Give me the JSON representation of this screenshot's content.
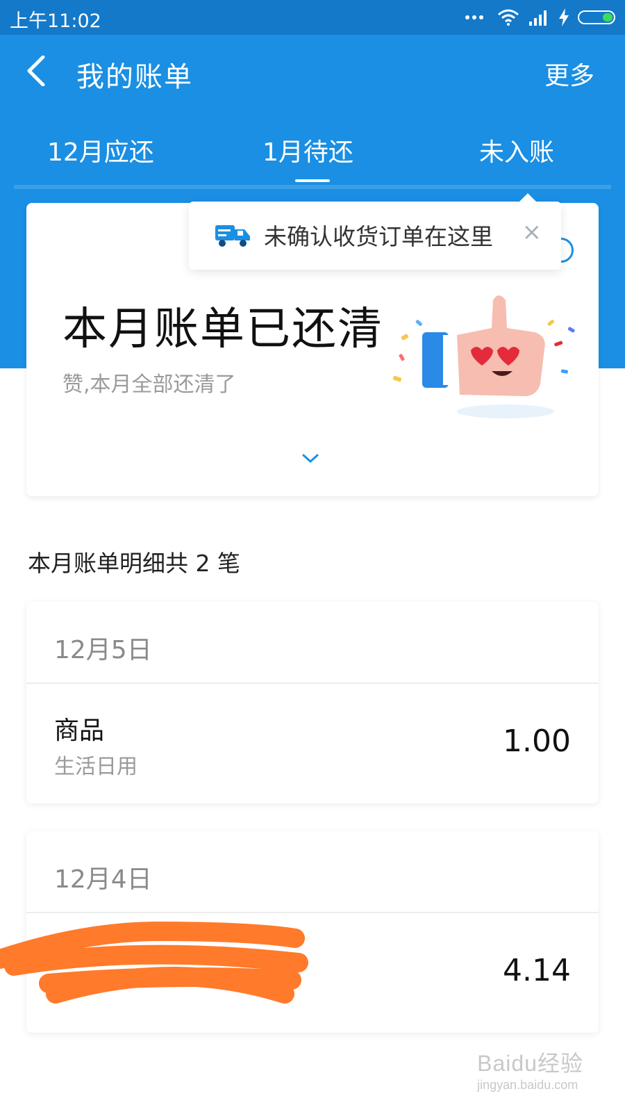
{
  "status_bar": {
    "time": "上午11:02",
    "icons": [
      "dots-icon",
      "wifi-icon",
      "signal-icon",
      "charging-icon",
      "battery-icon"
    ]
  },
  "header": {
    "title": "我的账单",
    "more_label": "更多",
    "back_icon": "chevron-left-icon"
  },
  "tabs": {
    "items": [
      {
        "label": "12月应还"
      },
      {
        "label": "1月待还",
        "selected": true
      },
      {
        "label": "未入账"
      }
    ]
  },
  "tooltip": {
    "text": "未确认收货订单在这里",
    "close_label": "×",
    "icon": "truck-icon"
  },
  "summary": {
    "title": "本月账单已还清",
    "subtitle": "赞,本月全部还清了",
    "illustration": "thumbs-up-icon"
  },
  "detail": {
    "heading": "本月账单明细共 2 笔"
  },
  "bills": [
    {
      "date": "12月5日",
      "name": "商品",
      "category": "生活日用",
      "amount": "1.00"
    },
    {
      "date": "12月4日",
      "name": "",
      "category": "",
      "amount": "4.14"
    }
  ],
  "colors": {
    "primary_blue": "#1a8fe3",
    "status_bar_blue": "#1479c9",
    "redaction_orange": "#ff7a2a"
  },
  "watermark": {
    "main": "Baidu经验",
    "sub": "jingyan.baidu.com"
  }
}
